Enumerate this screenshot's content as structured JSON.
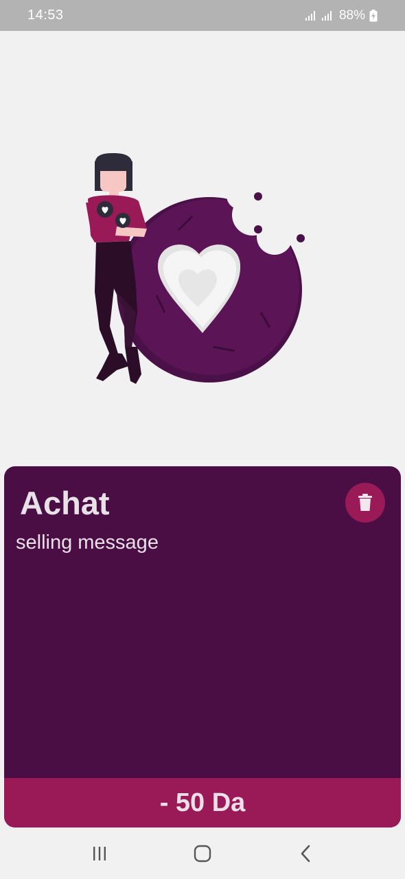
{
  "status_bar": {
    "time": "14:53",
    "battery": "88%"
  },
  "card": {
    "title": "Achat",
    "message": "selling message",
    "amount": "- 50 Da"
  },
  "icons": {
    "delete": "trash-icon",
    "nav_recents": "recents-icon",
    "nav_home": "home-icon",
    "nav_back": "back-icon"
  },
  "colors": {
    "card_background": "#4a0e44",
    "accent": "#9a1957",
    "page_background": "#f2f1f2"
  }
}
